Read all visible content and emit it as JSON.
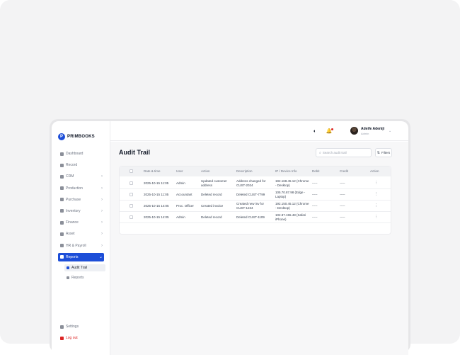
{
  "brand": {
    "name": "PRIMBOOKS",
    "mark": "P"
  },
  "sidebar": {
    "items": [
      {
        "label": "Dashboard",
        "has_chevron": false
      },
      {
        "label": "Record",
        "has_chevron": false
      },
      {
        "label": "CRM",
        "has_chevron": true
      },
      {
        "label": "Production",
        "has_chevron": true
      },
      {
        "label": "Purchase",
        "has_chevron": true
      },
      {
        "label": "Inventory",
        "has_chevron": true
      },
      {
        "label": "Finance",
        "has_chevron": true
      },
      {
        "label": "Asset",
        "has_chevron": true
      },
      {
        "label": "HR & Payroll",
        "has_chevron": true
      },
      {
        "label": "Reports",
        "has_chevron": true,
        "active": true
      }
    ],
    "sub_items": [
      {
        "label": "Audit Trail",
        "active": true
      },
      {
        "label": "Reports",
        "active": false
      }
    ],
    "bottom": [
      {
        "label": "Settings"
      },
      {
        "label": "Log out"
      }
    ],
    "chevron": "›",
    "chevron_open": "⌄"
  },
  "header": {
    "user_name": "Adeife Adeniji",
    "user_role": "Admin",
    "caret": "⌄",
    "theme_icon": "◐",
    "bell_icon": "🔔"
  },
  "page": {
    "title": "Audit Trail",
    "search_placeholder": "Search audit trail",
    "search_icon": "⌕",
    "filters_label": "Filters",
    "filters_icon": "⇅"
  },
  "table": {
    "columns": [
      "Date & time",
      "User",
      "Action",
      "Description",
      "IP / Device Info",
      "Debit",
      "Credit",
      "Action"
    ],
    "rows": [
      {
        "datetime": "2025-10-15 11:05",
        "user": "Admin",
        "action": "Updated customer address",
        "description": "Address changed for CUST-2024",
        "ip": "192.168.45.12 (Chrome - Desktop)",
        "debit": "-----",
        "credit": "-----"
      },
      {
        "datetime": "2025-10-15 11:05",
        "user": "Accountant",
        "action": "Deleted record",
        "description": "Deleted CUST-7799",
        "ip": "105.70.87.98 (Edge - Laptop)",
        "debit": "-----",
        "credit": "-----"
      },
      {
        "datetime": "2025-10-15 14:05",
        "user": "Proc. Officer",
        "action": "Created invoice",
        "description": "Created new inv for CUST-1234",
        "ip": "192.150.45.12 (Chrome - Desktop)",
        "debit": "-----",
        "credit": "-----"
      },
      {
        "datetime": "2025-10-15 14:05",
        "user": "Admin",
        "action": "Deleted record",
        "description": "Deleted CUST-1109",
        "ip": "102.87.155.48 (Safari iPhone)",
        "debit": "-----",
        "credit": "-----"
      }
    ],
    "row_menu_icon": "⋮"
  },
  "colors": {
    "accent": "#1d4ed8",
    "danger": "#dc2626",
    "text": "#1f2330",
    "muted": "#6b7280"
  }
}
